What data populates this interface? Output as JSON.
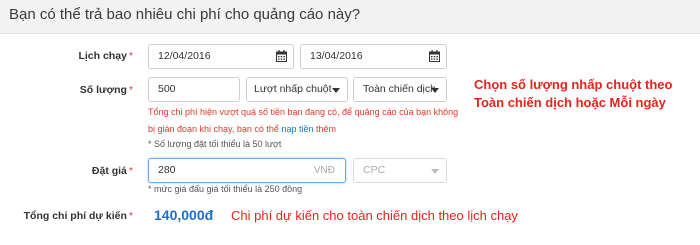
{
  "header": {
    "title": "Bạn có thể trả bao nhiêu chi phí cho quảng cáo này?"
  },
  "schedule": {
    "label": "Lịch chạy",
    "required_mark": "*",
    "start_date": "12/04/2016",
    "end_date": "13/04/2016"
  },
  "quantity": {
    "label": "Số lượng",
    "required_mark": "*",
    "value": "500",
    "metric_select": "Lượt nhấp chuột",
    "scope_select": "Toàn chiến dịch",
    "warning_line1": "Tổng chi phí hiện vượt quá số tiền bạn đang có, để quảng cáo của bạn không",
    "warning_line2_prefix": "bị gián đoạn khi chạy, bạn có thể",
    "warning_link": "nạp tiền",
    "warning_line2_suffix": "thêm",
    "hint": "* Số lượng đặt tối thiểu là 50 lượt"
  },
  "bid": {
    "label": "Đặt giá",
    "required_mark": "*",
    "value": "280",
    "unit": "VNĐ",
    "type_select": "CPC",
    "hint": "* mức giá đấu giá tối thiểu là 250 đồng"
  },
  "total": {
    "label": "Tổng chi phí dự kiến",
    "required_mark": "*",
    "value": "140,000đ"
  },
  "annotations": {
    "quantity_line1": "Chọn số lượng nhấp chuột theo",
    "quantity_line2": "Toàn chiến dịch hoặc Mỗi ngày",
    "total_note": "Chi phí dự kiến cho toàn chiến dịch theo lịch chạy"
  },
  "colors": {
    "accent": "#1a6fc9",
    "warning": "#e03a2a",
    "annotation": "#e8231a"
  },
  "icons": {
    "date": "calendar-icon",
    "select": "chevron-down-icon"
  }
}
